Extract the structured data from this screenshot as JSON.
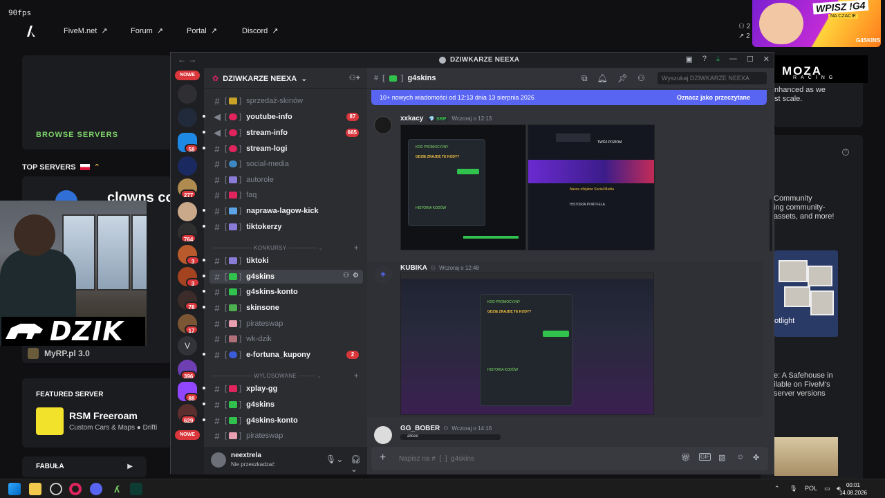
{
  "fivem": {
    "fps": "90fps",
    "nav": [
      {
        "label": "FiveM.net"
      },
      {
        "label": "Forum"
      },
      {
        "label": "Portal"
      },
      {
        "label": "Discord"
      }
    ],
    "browse_servers": "BROWSE SERVERS",
    "top_servers": "TOP SERVERS",
    "top_server_name": "clowns co",
    "streamer_logo": "DZIK",
    "myrp": "MyRP.pl 3.0",
    "featured": {
      "label": "FEATURED SERVER",
      "name": "RSM Freeroam",
      "sub": "Custom Cars & Maps ● Drifti"
    },
    "fabula": "FABUŁA",
    "right_text_1": "nhanced as we\nst scale.",
    "right_text_2": "Community\ning community-\nassets, and more!",
    "right_text_3": "otlight",
    "right_text_4": "e: A Safehouse in\nilable on FiveM's\nserver versions",
    "promo": {
      "title": "WPISZ !G4",
      "sub": "NA CZACIE",
      "brand": "G4SKINS"
    },
    "moza": {
      "big": "MOZA",
      "small": "RACING"
    },
    "counts": [
      "2",
      "2"
    ]
  },
  "discord": {
    "window_title": "DZIWKARZE NEEXA",
    "server_name": "DZIWKARZE NEEXA",
    "guild_badges": [
      {
        "label": "NOWE"
      },
      {
        "label": "58"
      },
      {
        "label": "277"
      },
      {
        "label": "764"
      },
      {
        "label": "3"
      },
      {
        "label": "3"
      },
      {
        "label": "78"
      },
      {
        "label": "17"
      },
      {
        "label": "396"
      },
      {
        "label": "88"
      },
      {
        "label": "629"
      },
      {
        "label": "NOWE"
      }
    ],
    "guild_letter": "V",
    "channels": [
      {
        "name": "sprzedaż-skinów",
        "state": "read",
        "color": "#c9a227"
      },
      {
        "name": "youtube-info",
        "state": "unread",
        "color": "#e0245e",
        "count": "87"
      },
      {
        "name": "stream-info",
        "state": "unread",
        "color": "#e0245e",
        "count": "665"
      },
      {
        "name": "stream-logi",
        "state": "unread",
        "color": "#e0245e"
      },
      {
        "name": "social-media",
        "state": "read",
        "color": "#3b88c3"
      },
      {
        "name": "autorole",
        "state": "read",
        "color": "#8a7bd8"
      },
      {
        "name": "faq",
        "state": "read",
        "color": "#e0245e"
      },
      {
        "name": "naprawa-lagow-kick",
        "state": "unread",
        "color": "#5da3e8"
      },
      {
        "name": "tiktokerzy",
        "state": "unread",
        "color": "#8a7bd8"
      }
    ],
    "category_konkursy": "KONKURSY",
    "konkursy_channels": [
      {
        "name": "tiktoki",
        "state": "unread",
        "color": "#8a7bd8"
      },
      {
        "name": "g4skins",
        "state": "active",
        "color": "#31c24d"
      },
      {
        "name": "g4skins-konto",
        "state": "unread",
        "color": "#31c24d"
      },
      {
        "name": "skinsone",
        "state": "unread",
        "color": "#4caf50"
      },
      {
        "name": "pirateswap",
        "state": "read",
        "color": "#e8a0b0"
      },
      {
        "name": "wk-dzik",
        "state": "read",
        "color": "#b0707a"
      },
      {
        "name": "e-fortuna_kupony",
        "state": "unread",
        "color": "#3b5bdb",
        "count": "2"
      }
    ],
    "category_wylosowane": "WYLOSOWANE",
    "wylosowane_channels": [
      {
        "name": "xplay-gg",
        "state": "unread",
        "color": "#e0245e"
      },
      {
        "name": "g4skins",
        "state": "unread",
        "color": "#31c24d"
      },
      {
        "name": "g4skins-konto",
        "state": "unread",
        "color": "#31c24d"
      },
      {
        "name": "pirateswap",
        "state": "read",
        "color": "#e8a0b0"
      }
    ],
    "user": {
      "name": "neextrela",
      "status": "Nie przeszkadzać"
    },
    "chat": {
      "channel": "g4skins",
      "search_placeholder": "Wyszukaj DZIWKARZE NEEXA",
      "new_messages": "10+ nowych wiadomości od 12:13 dnia 13 sierpnia 2026",
      "mark_read": "Oznacz jako przeczytane",
      "messages": [
        {
          "author": "xxkacy",
          "tag": "SRP",
          "time": "Wczoraj o 12:13"
        },
        {
          "author": "KUBIKA",
          "time": "Wczoraj o 12:48"
        },
        {
          "author": "GG_BOBER",
          "time": "Wczoraj o 14:16",
          "reply": "alicee"
        }
      ],
      "promo_popup_title": "KOD PROMOCYJNY",
      "promo_popup_ask": "GDZIE ZNAJDĘ TE KODY?",
      "promo_history": "HISTORIA KODÓW",
      "twoj_poziom": "TWÓJ POZIOM",
      "social_media_banner": "Nasze oficjalne Social Media",
      "historia_portfela": "HISTORIA PORTFELA",
      "composer_placeholder": "Napisz na #  [  ]  g4skins"
    }
  },
  "taskbar": {
    "lang": "POL",
    "time": "00:01",
    "date": "14.08.2026"
  }
}
